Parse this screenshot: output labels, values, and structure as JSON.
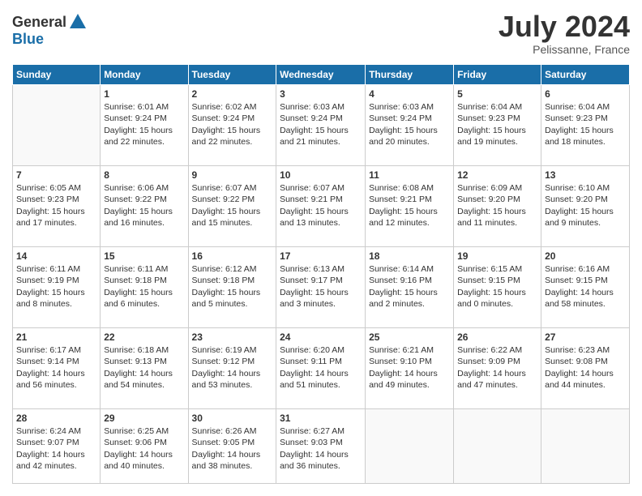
{
  "logo": {
    "general": "General",
    "blue": "Blue"
  },
  "title": "July 2024",
  "location": "Pelissanne, France",
  "days_header": [
    "Sunday",
    "Monday",
    "Tuesday",
    "Wednesday",
    "Thursday",
    "Friday",
    "Saturday"
  ],
  "weeks": [
    [
      {
        "day": "",
        "content": ""
      },
      {
        "day": "1",
        "content": "Sunrise: 6:01 AM\nSunset: 9:24 PM\nDaylight: 15 hours\nand 22 minutes."
      },
      {
        "day": "2",
        "content": "Sunrise: 6:02 AM\nSunset: 9:24 PM\nDaylight: 15 hours\nand 22 minutes."
      },
      {
        "day": "3",
        "content": "Sunrise: 6:03 AM\nSunset: 9:24 PM\nDaylight: 15 hours\nand 21 minutes."
      },
      {
        "day": "4",
        "content": "Sunrise: 6:03 AM\nSunset: 9:24 PM\nDaylight: 15 hours\nand 20 minutes."
      },
      {
        "day": "5",
        "content": "Sunrise: 6:04 AM\nSunset: 9:23 PM\nDaylight: 15 hours\nand 19 minutes."
      },
      {
        "day": "6",
        "content": "Sunrise: 6:04 AM\nSunset: 9:23 PM\nDaylight: 15 hours\nand 18 minutes."
      }
    ],
    [
      {
        "day": "7",
        "content": "Sunrise: 6:05 AM\nSunset: 9:23 PM\nDaylight: 15 hours\nand 17 minutes."
      },
      {
        "day": "8",
        "content": "Sunrise: 6:06 AM\nSunset: 9:22 PM\nDaylight: 15 hours\nand 16 minutes."
      },
      {
        "day": "9",
        "content": "Sunrise: 6:07 AM\nSunset: 9:22 PM\nDaylight: 15 hours\nand 15 minutes."
      },
      {
        "day": "10",
        "content": "Sunrise: 6:07 AM\nSunset: 9:21 PM\nDaylight: 15 hours\nand 13 minutes."
      },
      {
        "day": "11",
        "content": "Sunrise: 6:08 AM\nSunset: 9:21 PM\nDaylight: 15 hours\nand 12 minutes."
      },
      {
        "day": "12",
        "content": "Sunrise: 6:09 AM\nSunset: 9:20 PM\nDaylight: 15 hours\nand 11 minutes."
      },
      {
        "day": "13",
        "content": "Sunrise: 6:10 AM\nSunset: 9:20 PM\nDaylight: 15 hours\nand 9 minutes."
      }
    ],
    [
      {
        "day": "14",
        "content": "Sunrise: 6:11 AM\nSunset: 9:19 PM\nDaylight: 15 hours\nand 8 minutes."
      },
      {
        "day": "15",
        "content": "Sunrise: 6:11 AM\nSunset: 9:18 PM\nDaylight: 15 hours\nand 6 minutes."
      },
      {
        "day": "16",
        "content": "Sunrise: 6:12 AM\nSunset: 9:18 PM\nDaylight: 15 hours\nand 5 minutes."
      },
      {
        "day": "17",
        "content": "Sunrise: 6:13 AM\nSunset: 9:17 PM\nDaylight: 15 hours\nand 3 minutes."
      },
      {
        "day": "18",
        "content": "Sunrise: 6:14 AM\nSunset: 9:16 PM\nDaylight: 15 hours\nand 2 minutes."
      },
      {
        "day": "19",
        "content": "Sunrise: 6:15 AM\nSunset: 9:15 PM\nDaylight: 15 hours\nand 0 minutes."
      },
      {
        "day": "20",
        "content": "Sunrise: 6:16 AM\nSunset: 9:15 PM\nDaylight: 14 hours\nand 58 minutes."
      }
    ],
    [
      {
        "day": "21",
        "content": "Sunrise: 6:17 AM\nSunset: 9:14 PM\nDaylight: 14 hours\nand 56 minutes."
      },
      {
        "day": "22",
        "content": "Sunrise: 6:18 AM\nSunset: 9:13 PM\nDaylight: 14 hours\nand 54 minutes."
      },
      {
        "day": "23",
        "content": "Sunrise: 6:19 AM\nSunset: 9:12 PM\nDaylight: 14 hours\nand 53 minutes."
      },
      {
        "day": "24",
        "content": "Sunrise: 6:20 AM\nSunset: 9:11 PM\nDaylight: 14 hours\nand 51 minutes."
      },
      {
        "day": "25",
        "content": "Sunrise: 6:21 AM\nSunset: 9:10 PM\nDaylight: 14 hours\nand 49 minutes."
      },
      {
        "day": "26",
        "content": "Sunrise: 6:22 AM\nSunset: 9:09 PM\nDaylight: 14 hours\nand 47 minutes."
      },
      {
        "day": "27",
        "content": "Sunrise: 6:23 AM\nSunset: 9:08 PM\nDaylight: 14 hours\nand 44 minutes."
      }
    ],
    [
      {
        "day": "28",
        "content": "Sunrise: 6:24 AM\nSunset: 9:07 PM\nDaylight: 14 hours\nand 42 minutes."
      },
      {
        "day": "29",
        "content": "Sunrise: 6:25 AM\nSunset: 9:06 PM\nDaylight: 14 hours\nand 40 minutes."
      },
      {
        "day": "30",
        "content": "Sunrise: 6:26 AM\nSunset: 9:05 PM\nDaylight: 14 hours\nand 38 minutes."
      },
      {
        "day": "31",
        "content": "Sunrise: 6:27 AM\nSunset: 9:03 PM\nDaylight: 14 hours\nand 36 minutes."
      },
      {
        "day": "",
        "content": ""
      },
      {
        "day": "",
        "content": ""
      },
      {
        "day": "",
        "content": ""
      }
    ]
  ]
}
